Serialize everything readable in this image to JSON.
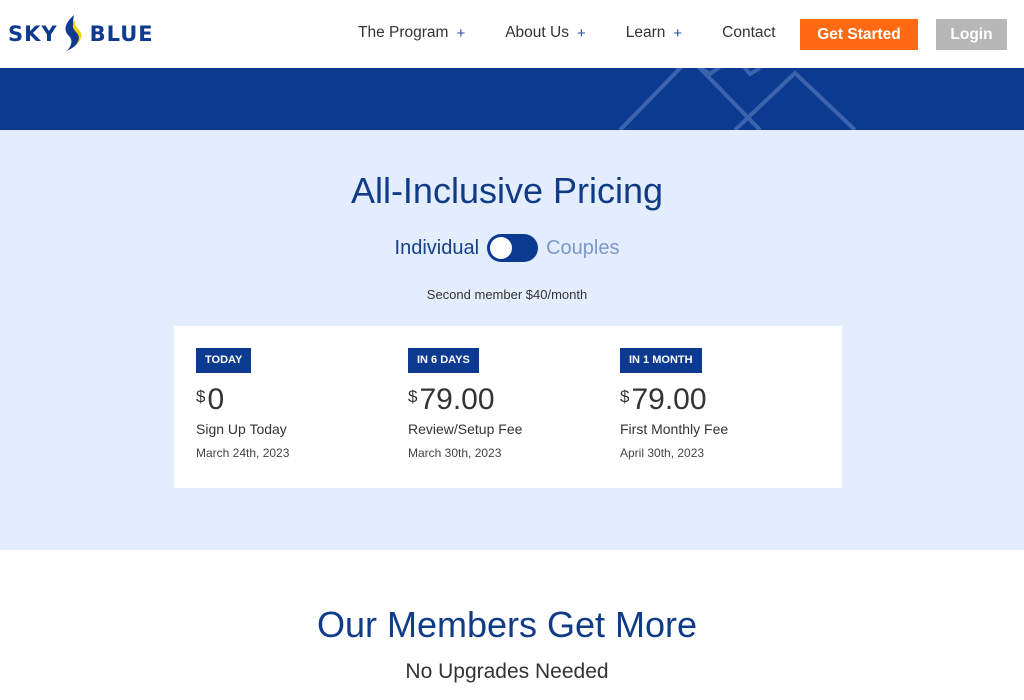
{
  "header": {
    "logo": {
      "left_text": "SKY",
      "right_text": "BLUE"
    },
    "nav": [
      {
        "label": "The Program",
        "has_submenu": true
      },
      {
        "label": "About Us",
        "has_submenu": true
      },
      {
        "label": "Learn",
        "has_submenu": true
      },
      {
        "label": "Contact",
        "has_submenu": false
      }
    ],
    "submenu_glyph": "+",
    "get_started_label": "Get Started",
    "login_label": "Login"
  },
  "pricing": {
    "title": "All-Inclusive Pricing",
    "toggle": {
      "left_label": "Individual",
      "right_label": "Couples",
      "selected": "Individual"
    },
    "second_member_note": "Second member $40/month",
    "currency_symbol": "$",
    "tiers": [
      {
        "tag": "TODAY",
        "amount": "0",
        "label": "Sign Up Today",
        "date": "March 24th, 2023"
      },
      {
        "tag": "IN 6 DAYS",
        "amount": "79.00",
        "label": "Review/Setup Fee",
        "date": "March 30th, 2023"
      },
      {
        "tag": "IN 1 MONTH",
        "amount": "79.00",
        "label": "First Monthly Fee",
        "date": "April 30th, 2023"
      }
    ]
  },
  "members": {
    "title": "Our Members Get More",
    "subtitle": "No Upgrades Needed"
  },
  "colors": {
    "brand_blue": "#0d3a91",
    "heading_blue": "#103b86",
    "accent_orange": "#ff6a13",
    "login_gray": "#b7b7b7",
    "pricing_bg": "#e3edfd"
  },
  "icons": {
    "logo": "sky-blue-logo-mark",
    "submenu": "plus-icon"
  }
}
